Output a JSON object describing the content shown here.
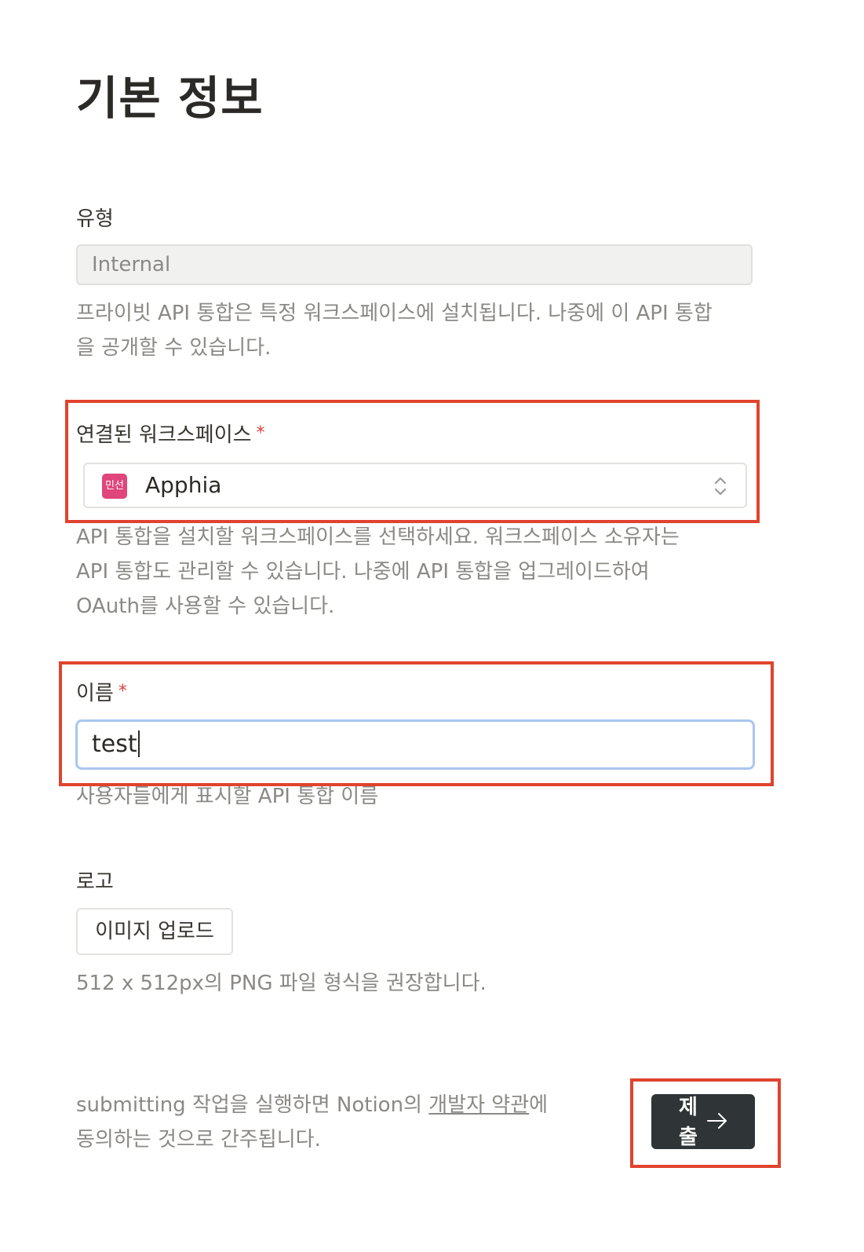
{
  "page_title": "기본 정보",
  "type_section": {
    "label": "유형",
    "value": "Internal",
    "help_line1": "프라이빗 API 통합은 특정 워크스페이스에 설치됩니다. 나중에 이 API 통합",
    "help_line2": "을 공개할 수 있습니다."
  },
  "workspace_section": {
    "label": "연결된 워크스페이스",
    "required_mark": "*",
    "badge_text": "민선",
    "badge_color": "#e0457b",
    "selected_value": "Apphia",
    "help_line1": "API 통합을 설치할 워크스페이스를 선택하세요. 워크스페이스 소유자는",
    "help_line2": "API 통합도 관리할 수 있습니다. 나중에 API 통합을 업그레이드하여",
    "help_line3": "OAuth를 사용할 수 있습니다."
  },
  "name_section": {
    "label": "이름",
    "required_mark": "*",
    "value": "test",
    "help": "사용자들에게 표시할 API 통합 이름"
  },
  "logo_section": {
    "label": "로고",
    "upload_button": "이미지 업로드",
    "help": "512 x 512px의 PNG 파일 형식을 권장합니다."
  },
  "footer": {
    "terms_prefix": "submitting 작업을 실행하면 Notion의 ",
    "terms_link": "개발자 약관",
    "terms_suffix": "에",
    "terms_line2": "동의하는 것으로 간주됩니다.",
    "submit_label": "제출",
    "submit_icon": "arrow-right-icon"
  },
  "highlight_color": "#e0432e"
}
